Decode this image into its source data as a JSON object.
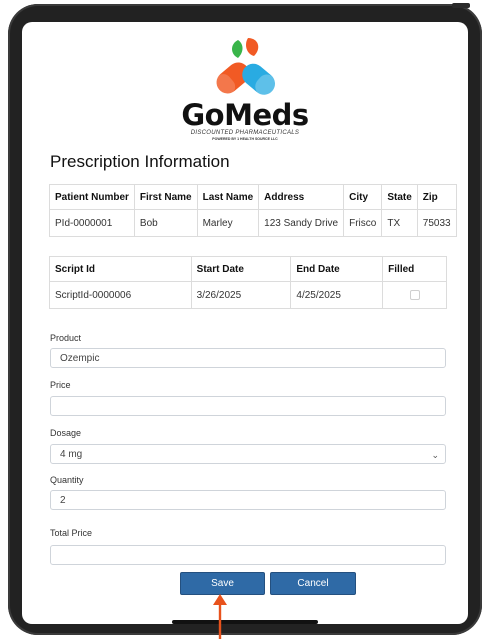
{
  "brand": {
    "name": "GoMeds",
    "tagline": "DISCOUNTED PHARMACEUTICALS",
    "powered_by": "POWERED BY 1 HEALTH SOURCE LLC",
    "colors": {
      "orange": "#F15A24",
      "blue": "#29ABE2",
      "green": "#39B54A",
      "dark": "#1B1B1B"
    }
  },
  "section_title": "Prescription Information",
  "patient_table": {
    "headers": [
      "Patient Number",
      "First Name",
      "Last Name",
      "Address",
      "City",
      "State",
      "Zip"
    ],
    "rows": [
      [
        "PId-0000001",
        "Bob",
        "Marley",
        "123 Sandy Drive",
        "Frisco",
        "TX",
        "75033"
      ]
    ]
  },
  "script_table": {
    "headers": [
      "Script Id",
      "Start Date",
      "End Date",
      "Filled"
    ],
    "rows": [
      {
        "script_id": "ScriptId-0000006",
        "start_date": "3/26/2025",
        "end_date": "4/25/2025",
        "filled": false
      }
    ]
  },
  "form": {
    "product": {
      "label": "Product",
      "value": "Ozempic"
    },
    "price": {
      "label": "Price",
      "value": ""
    },
    "dosage": {
      "label": "Dosage",
      "value": "4 mg"
    },
    "quantity": {
      "label": "Quantity",
      "value": "2"
    },
    "total_price": {
      "label": "Total Price",
      "value": ""
    }
  },
  "buttons": {
    "save": "Save",
    "cancel": "Cancel"
  },
  "accent_colors": {
    "button": "#2F6AA6",
    "pointer": "#E8521C"
  }
}
